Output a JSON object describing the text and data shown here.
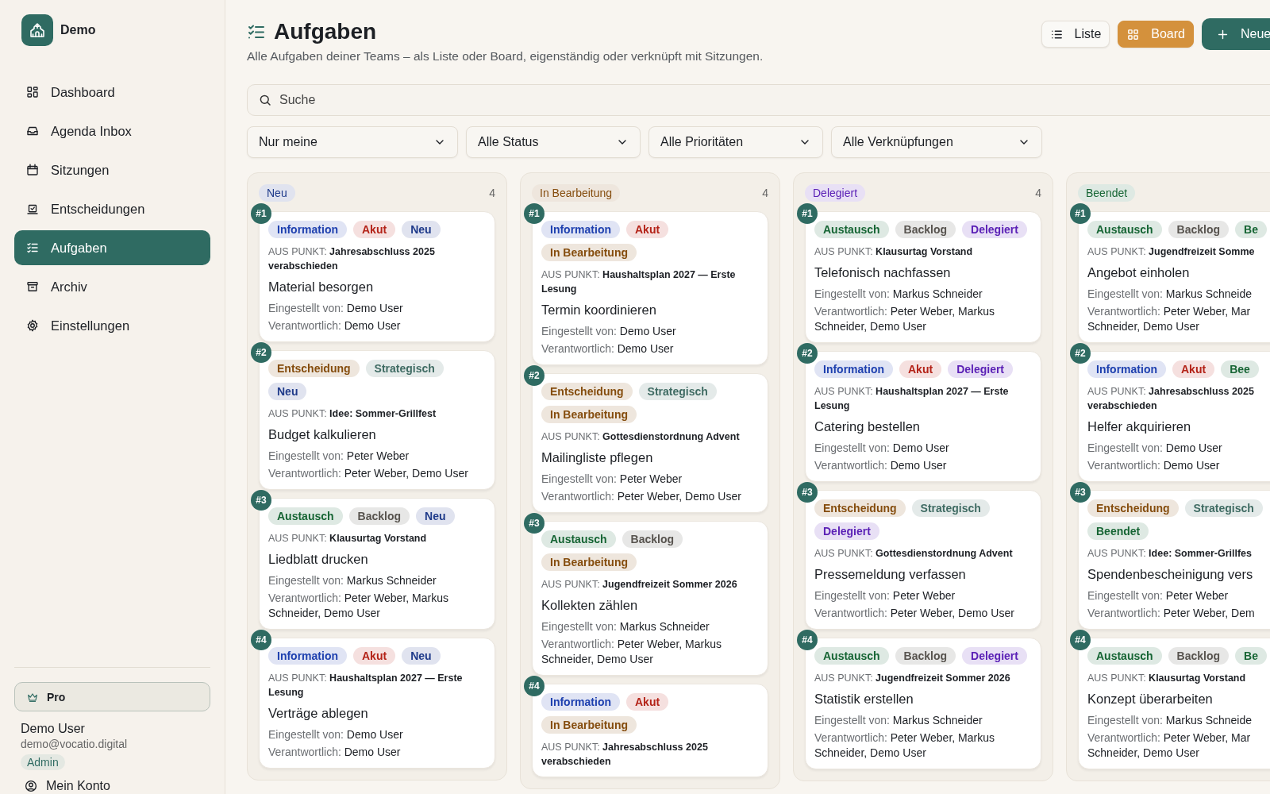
{
  "app": {
    "name": "Demo"
  },
  "sidebar": {
    "items": [
      {
        "label": "Dashboard",
        "selected": false
      },
      {
        "label": "Agenda Inbox",
        "selected": false
      },
      {
        "label": "Sitzungen",
        "selected": false
      },
      {
        "label": "Entscheidungen",
        "selected": false
      },
      {
        "label": "Aufgaben",
        "selected": true
      },
      {
        "label": "Archiv",
        "selected": false
      },
      {
        "label": "Einstellungen",
        "selected": false
      }
    ],
    "plan": "Pro",
    "user": {
      "name": "Demo User",
      "email": "demo@vocatio.digital",
      "role": "Admin"
    },
    "account_link": "Mein Konto"
  },
  "header": {
    "title": "Aufgaben",
    "subtitle": "Alle Aufgaben deiner Teams – als Liste oder Board, eigenständig oder verknüpft mit Sitzungen.",
    "views": [
      {
        "label": "Liste",
        "selected": false
      },
      {
        "label": "Board",
        "selected": true
      }
    ],
    "new_button": "Neue"
  },
  "search": {
    "placeholder": "Suche"
  },
  "filters": [
    "Nur meine",
    "Alle Status",
    "Alle Prioritäten",
    "Alle Verknüpfungen"
  ],
  "columns": [
    {
      "status": "Neu",
      "color": "#1e3a8a",
      "count": "4",
      "cards": [
        {
          "number": "#1",
          "tags": [
            {
              "text": "Information",
              "color": "#1e40af"
            },
            {
              "text": "Akut",
              "color": "#b42318"
            },
            {
              "text": "Neu",
              "color": "#1e3a8a"
            }
          ],
          "source_label": "AUS PUNKT:",
          "source": "Jahresabschluss 2025\nverabschieden",
          "title": "Material besorgen",
          "created_label": "Eingestellt von:",
          "created_by": "Demo User",
          "responsible_label": "Verantwortlich:",
          "responsible": "Demo User"
        },
        {
          "number": "#2",
          "tags": [
            {
              "text": "Entscheidung",
              "color": "#854d0e"
            },
            {
              "text": "Strategisch",
              "color": "#3f6b63"
            },
            {
              "text": "Neu",
              "color": "#1e3a8a"
            }
          ],
          "source_label": "AUS PUNKT:",
          "source": "Idee: Sommer-Grillfest",
          "title": "Budget kalkulieren",
          "created_label": "Eingestellt von:",
          "created_by": "Peter Weber",
          "responsible_label": "Verantwortlich:",
          "responsible": "Peter Weber, Demo User"
        },
        {
          "number": "#3",
          "tags": [
            {
              "text": "Austausch",
              "color": "#166534"
            },
            {
              "text": "Backlog",
              "color": "#57534e"
            },
            {
              "text": "Neu",
              "color": "#1e3a8a"
            }
          ],
          "source_label": "AUS PUNKT:",
          "source": "Klausurtag Vorstand",
          "title": "Liedblatt drucken",
          "created_label": "Eingestellt von:",
          "created_by": "Markus Schneider",
          "responsible_label": "Verantwortlich:",
          "responsible": "Peter Weber, Markus\nSchneider, Demo User"
        },
        {
          "number": "#4",
          "tags": [
            {
              "text": "Information",
              "color": "#1e40af"
            },
            {
              "text": "Akut",
              "color": "#b42318"
            },
            {
              "text": "Neu",
              "color": "#1e3a8a"
            }
          ],
          "source_label": "AUS PUNKT:",
          "source": "Haushaltsplan 2027 — Erste\nLesung",
          "title": "Verträge ablegen",
          "created_label": "Eingestellt von:",
          "created_by": "Demo User",
          "responsible_label": "Verantwortlich:",
          "responsible": "Demo User"
        }
      ]
    },
    {
      "status": "In Bearbeitung",
      "color": "#854d0e",
      "count": "4",
      "cards": [
        {
          "number": "#1",
          "tags": [
            {
              "text": "Information",
              "color": "#1e40af"
            },
            {
              "text": "Akut",
              "color": "#b42318"
            },
            {
              "text": "In Bearbeitung",
              "color": "#854d0e"
            }
          ],
          "source_label": "AUS PUNKT:",
          "source": "Haushaltsplan 2027 — Erste\nLesung",
          "title": "Termin koordinieren",
          "created_label": "Eingestellt von:",
          "created_by": "Demo User",
          "responsible_label": "Verantwortlich:",
          "responsible": "Demo User"
        },
        {
          "number": "#2",
          "tags": [
            {
              "text": "Entscheidung",
              "color": "#854d0e"
            },
            {
              "text": "Strategisch",
              "color": "#3f6b63"
            },
            {
              "text": "In Bearbeitung",
              "color": "#854d0e"
            }
          ],
          "source_label": "AUS PUNKT:",
          "source": "Gottesdienstordnung Advent",
          "title": "Mailingliste pflegen",
          "created_label": "Eingestellt von:",
          "created_by": "Peter Weber",
          "responsible_label": "Verantwortlich:",
          "responsible": "Peter Weber, Demo User"
        },
        {
          "number": "#3",
          "tags": [
            {
              "text": "Austausch",
              "color": "#166534"
            },
            {
              "text": "Backlog",
              "color": "#57534e"
            },
            {
              "text": "In Bearbeitung",
              "color": "#854d0e"
            }
          ],
          "source_label": "AUS PUNKT:",
          "source": "Jugendfreizeit Sommer 2026",
          "title": "Kollekten zählen",
          "created_label": "Eingestellt von:",
          "created_by": "Markus Schneider",
          "responsible_label": "Verantwortlich:",
          "responsible": "Peter Weber, Markus\nSchneider, Demo User"
        },
        {
          "number": "#4",
          "tags": [
            {
              "text": "Information",
              "color": "#1e40af"
            },
            {
              "text": "Akut",
              "color": "#b42318"
            },
            {
              "text": "In Bearbeitung",
              "color": "#854d0e"
            }
          ],
          "source_label": "AUS PUNKT:",
          "source": "Jahresabschluss 2025\nverabschieden"
        }
      ]
    },
    {
      "status": "Delegiert",
      "color": "#5b21b6",
      "count": "4",
      "cards": [
        {
          "number": "#1",
          "tags": [
            {
              "text": "Austausch",
              "color": "#166534"
            },
            {
              "text": "Backlog",
              "color": "#57534e"
            },
            {
              "text": "Delegiert",
              "color": "#5b21b6"
            }
          ],
          "source_label": "AUS PUNKT:",
          "source": "Klausurtag Vorstand",
          "title": "Telefonisch nachfassen",
          "created_label": "Eingestellt von:",
          "created_by": "Markus Schneider",
          "responsible_label": "Verantwortlich:",
          "responsible": "Peter Weber, Markus\nSchneider, Demo User"
        },
        {
          "number": "#2",
          "tags": [
            {
              "text": "Information",
              "color": "#1e40af"
            },
            {
              "text": "Akut",
              "color": "#b42318"
            },
            {
              "text": "Delegiert",
              "color": "#5b21b6"
            }
          ],
          "source_label": "AUS PUNKT:",
          "source": "Haushaltsplan 2027 — Erste\nLesung",
          "title": "Catering bestellen",
          "created_label": "Eingestellt von:",
          "created_by": "Demo User",
          "responsible_label": "Verantwortlich:",
          "responsible": "Demo User"
        },
        {
          "number": "#3",
          "tags": [
            {
              "text": "Entscheidung",
              "color": "#854d0e"
            },
            {
              "text": "Strategisch",
              "color": "#3f6b63"
            },
            {
              "text": "Delegiert",
              "color": "#5b21b6"
            }
          ],
          "source_label": "AUS PUNKT:",
          "source": "Gottesdienstordnung Advent",
          "title": "Pressemeldung verfassen",
          "created_label": "Eingestellt von:",
          "created_by": "Peter Weber",
          "responsible_label": "Verantwortlich:",
          "responsible": "Peter Weber, Demo User"
        },
        {
          "number": "#4",
          "tags": [
            {
              "text": "Austausch",
              "color": "#166534"
            },
            {
              "text": "Backlog",
              "color": "#57534e"
            },
            {
              "text": "Delegiert",
              "color": "#5b21b6"
            }
          ],
          "source_label": "AUS PUNKT:",
          "source": "Jugendfreizeit Sommer 2026",
          "title": "Statistik erstellen",
          "created_label": "Eingestellt von:",
          "created_by": "Markus Schneider",
          "responsible_label": "Verantwortlich:",
          "responsible": "Peter Weber, Markus\nSchneider, Demo User"
        }
      ]
    },
    {
      "status": "Beendet",
      "color": "#166534",
      "cards": [
        {
          "number": "#1",
          "tags": [
            {
              "text": "Austausch",
              "color": "#166534"
            },
            {
              "text": "Backlog",
              "color": "#57534e"
            },
            {
              "text": "Be",
              "color": "#166534"
            }
          ],
          "source_label": "AUS PUNKT:",
          "source": "Jugendfreizeit Somme",
          "title": "Angebot einholen",
          "created_label": "Eingestellt von:",
          "created_by": "Markus Schneide",
          "responsible_label": "Verantwortlich:",
          "responsible": "Peter Weber, Mar\nSchneider, Demo User"
        },
        {
          "number": "#2",
          "tags": [
            {
              "text": "Information",
              "color": "#1e40af"
            },
            {
              "text": "Akut",
              "color": "#b42318"
            },
            {
              "text": "Bee",
              "color": "#166534"
            }
          ],
          "source_label": "AUS PUNKT:",
          "source": "Jahresabschluss 2025\nverabschieden",
          "title": "Helfer akquirieren",
          "created_label": "Eingestellt von:",
          "created_by": "Demo User",
          "responsible_label": "Verantwortlich:",
          "responsible": "Demo User"
        },
        {
          "number": "#3",
          "tags": [
            {
              "text": "Entscheidung",
              "color": "#854d0e"
            },
            {
              "text": "Strategisch",
              "color": "#3f6b63"
            },
            {
              "text": "Beendet",
              "color": "#166534"
            }
          ],
          "source_label": "AUS PUNKT:",
          "source": "Idee: Sommer-Grillfes",
          "title": "Spendenbescheinigung vers",
          "created_label": "Eingestellt von:",
          "created_by": "Peter Weber",
          "responsible_label": "Verantwortlich:",
          "responsible": "Peter Weber, Dem"
        },
        {
          "number": "#4",
          "tags": [
            {
              "text": "Austausch",
              "color": "#166534"
            },
            {
              "text": "Backlog",
              "color": "#57534e"
            },
            {
              "text": "Be",
              "color": "#166534"
            }
          ],
          "source_label": "AUS PUNKT:",
          "source": "Klausurtag Vorstand",
          "title": "Konzept überarbeiten",
          "created_label": "Eingestellt von:",
          "created_by": "Markus Schneide",
          "responsible_label": "Verantwortlich:",
          "responsible": "Peter Weber, Mar\nSchneider, Demo User"
        }
      ]
    }
  ]
}
